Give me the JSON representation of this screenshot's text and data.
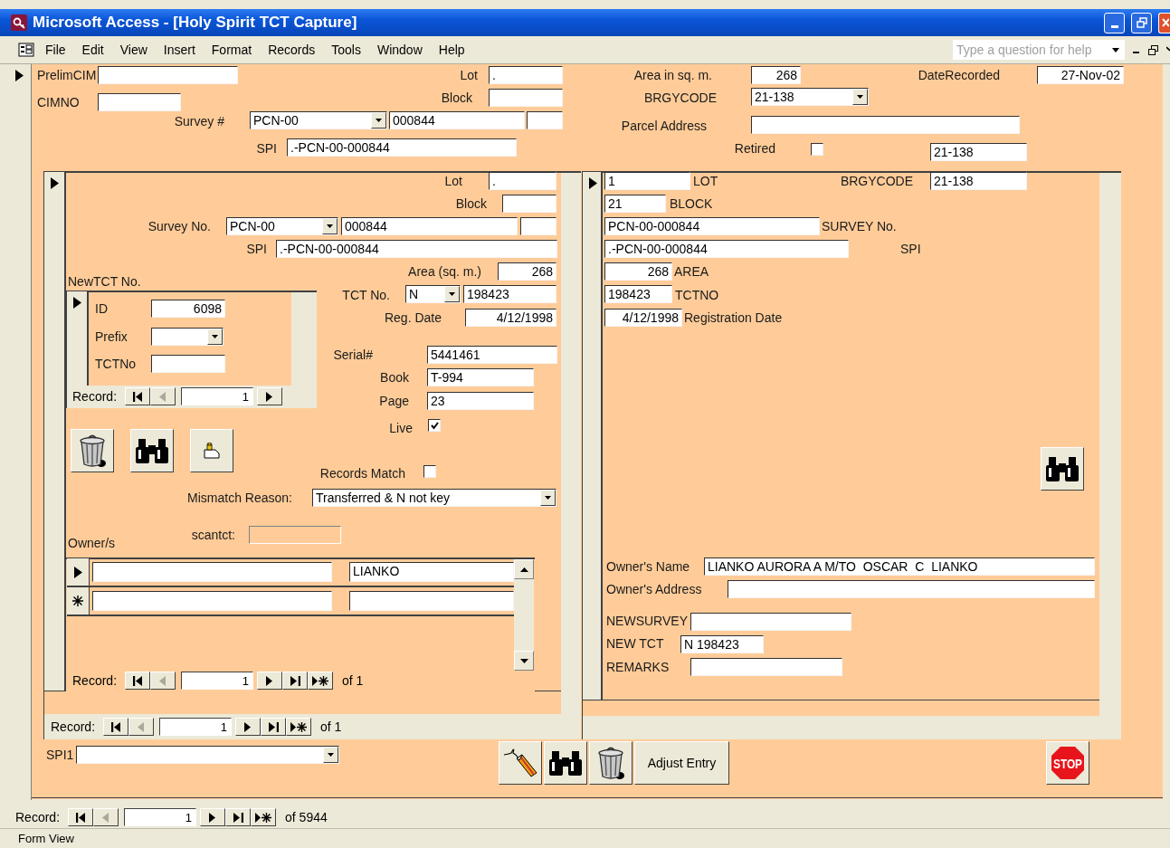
{
  "window": {
    "title": "Microsoft Access - [Holy Spirit TCT Capture]"
  },
  "menu": [
    "File",
    "Edit",
    "View",
    "Insert",
    "Format",
    "Records",
    "Tools",
    "Window",
    "Help"
  ],
  "help_box": {
    "placeholder": "Type a question for help"
  },
  "main_form": {
    "prelim_cim": {
      "label": "PrelimCIM"
    },
    "cimno": {
      "label": "CIMNO"
    },
    "lot": {
      "label": "Lot",
      "value": "."
    },
    "block": {
      "label": "Block"
    },
    "survey": {
      "label": "Survey #",
      "prefix": "PCN-00",
      "number": "000844"
    },
    "spi": {
      "label": "SPI",
      "value": ".-PCN-00-000844"
    },
    "area": {
      "label": "Area in sq. m.",
      "value": "268"
    },
    "date_recorded": {
      "label": "DateRecorded",
      "value": "27-Nov-02"
    },
    "brgycode": {
      "label": "BRGYCODE",
      "value": "21-138"
    },
    "parcel_address": {
      "label": "Parcel Address"
    },
    "retired": {
      "label": "Retired",
      "checked": false
    },
    "unlabeled_field": {
      "value": "21-138"
    }
  },
  "left_subform": {
    "lot": {
      "label": "Lot",
      "value": "."
    },
    "block": {
      "label": "Block"
    },
    "survey_no": {
      "label": "Survey No.",
      "prefix": "PCN-00",
      "number": "000844"
    },
    "spi": {
      "label": "SPI",
      "value": ".-PCN-00-000844"
    },
    "area": {
      "label": "Area (sq. m.)",
      "value": "268"
    },
    "new_tct_no": {
      "label": "NewTCT No."
    },
    "tct_no": {
      "label": "TCT No.",
      "prefix": "N",
      "number": "198423"
    },
    "reg_date": {
      "label": "Reg. Date",
      "value": "4/12/1998"
    },
    "serial": {
      "label": "Serial#",
      "value": "5441461"
    },
    "book": {
      "label": "Book",
      "value": "T-994"
    },
    "page": {
      "label": "Page",
      "value": "23"
    },
    "live": {
      "label": "Live",
      "checked": true
    },
    "records_match": {
      "label": "Records Match",
      "checked": false
    },
    "mismatch_reason": {
      "label": "Mismatch Reason:",
      "value": "Transferred & N not key"
    },
    "scantct": {
      "label": "scantct:"
    },
    "buttons": [
      {
        "kind": "delete"
      },
      {
        "kind": "find"
      },
      {
        "kind": "note"
      }
    ],
    "new_tct": {
      "id": {
        "label": "ID",
        "value": "6098"
      },
      "prefix": {
        "label": "Prefix"
      },
      "tct_no": {
        "label": "TCTNo"
      },
      "navigation": {
        "label": "Record:",
        "current": "1"
      }
    },
    "owners": {
      "label": "Owner/s",
      "rows": [
        {
          "kind": "current",
          "column_2": "LIANKO"
        },
        {
          "kind": "new"
        }
      ],
      "navigation": {
        "label": "Record:",
        "current": "1",
        "of_label": "of",
        "total": "1"
      }
    },
    "navigation": {
      "label": "Record:",
      "current": "1",
      "of_label": "of",
      "total": "1"
    }
  },
  "right_subform": {
    "lot": {
      "label": "LOT",
      "value": "1"
    },
    "brgycode": {
      "label": "BRGYCODE",
      "value": "21-138"
    },
    "block": {
      "label": "BLOCK",
      "value": "21"
    },
    "survey_no": {
      "label": "SURVEY No.",
      "value": "PCN-00-000844"
    },
    "spi": {
      "label": "SPI",
      "value": ".-PCN-00-000844"
    },
    "area": {
      "label": "AREA",
      "value": "268"
    },
    "tct_no": {
      "label": "TCTNO",
      "value": "198423"
    },
    "registration_date": {
      "label": "Registration Date",
      "value": "4/12/1998"
    },
    "buttons": [
      {
        "kind": "find"
      }
    ],
    "owners_name": {
      "label": "Owner's Name",
      "value": "LIANKO AURORA A M/TO  OSCAR  C  LIANKO"
    },
    "owners_address": {
      "label": "Owner's Address"
    },
    "new_survey_no": {
      "label": "NEWSURVEY"
    },
    "new_tct": {
      "label": "NEW TCT",
      "value": "N 198423"
    },
    "remarks": {
      "label": "REMARKS"
    }
  },
  "footer": {
    "spi1": {
      "label": "SPI1"
    },
    "buttons": [
      {
        "kind": "pen"
      },
      {
        "kind": "find"
      },
      {
        "kind": "delete"
      },
      {
        "kind": "text",
        "label": "Adjust Entry"
      }
    ],
    "stop_button": {
      "kind": "stop",
      "label": "STOP"
    }
  },
  "navigation": {
    "label": "Record:",
    "current": "1",
    "of_label": "of",
    "total": "5944"
  },
  "status_bar": {
    "text": "Form View"
  }
}
